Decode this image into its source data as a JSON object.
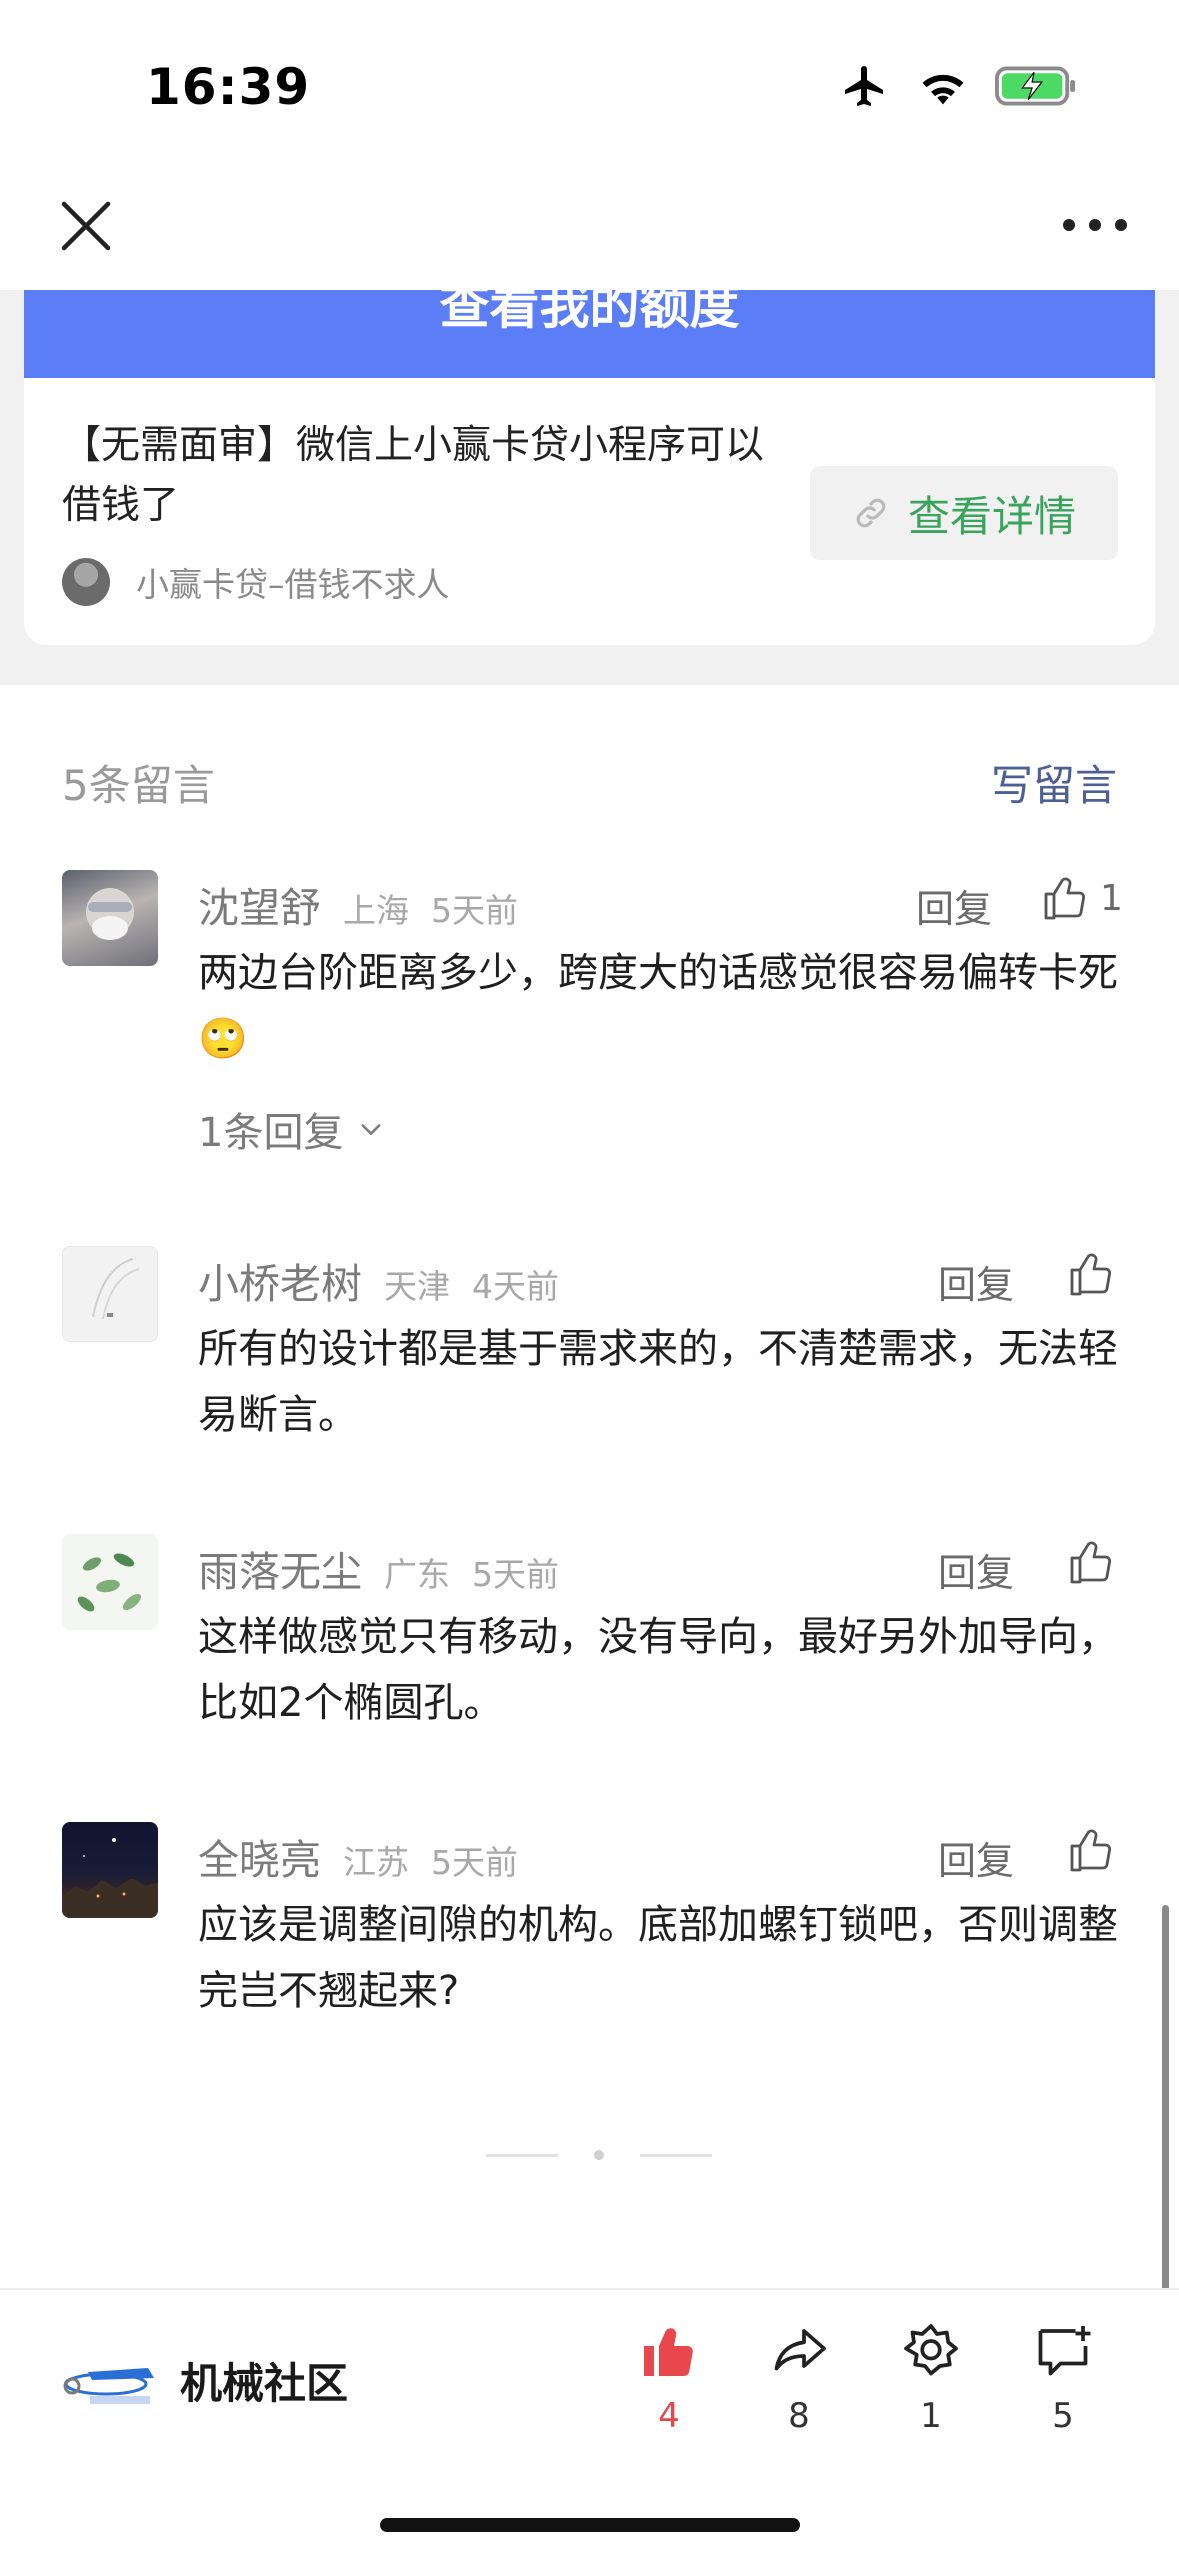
{
  "status": {
    "time": "16:39"
  },
  "ad": {
    "banner_text": "查看我的额度",
    "title": "【无需面审】微信上小赢卡贷小程序可以借钱了",
    "source": "小赢卡贷–借钱不求人",
    "button_label": "查看详情",
    "button_color": "#3aa35c"
  },
  "comments_header": {
    "count": "5条留言",
    "write": "写留言"
  },
  "comments": [
    {
      "name": "沈望舒",
      "region": "上海",
      "time": "5天前",
      "reply": "回复",
      "likes": "1",
      "text": "两边台阶距离多少，跨度大的话感觉很容易偏转卡死🙄",
      "replies_label": "1条回复"
    },
    {
      "name": "小桥老树",
      "region": "天津",
      "time": "4天前",
      "reply": "回复",
      "likes": "",
      "text": "所有的设计都是基于需求来的，不清楚需求，无法轻易断言。"
    },
    {
      "name": "雨落无尘",
      "region": "广东",
      "time": "5天前",
      "reply": "回复",
      "likes": "",
      "text": "这样做感觉只有移动，没有导向，最好另外加导向，比如2个椭圆孔。"
    },
    {
      "name": "全晓亮",
      "region": "江苏",
      "time": "5天前",
      "reply": "回复",
      "likes": "",
      "text": "应该是调整间隙的机构。底部加螺钉锁吧，否则调整完岂不翘起来?"
    }
  ],
  "bottom": {
    "brand_name": "机械社区",
    "actions": [
      {
        "icon": "thumbs-up-filled-icon",
        "count": "4",
        "color": "#e8474c"
      },
      {
        "icon": "share-icon",
        "count": "8"
      },
      {
        "icon": "wow-icon",
        "count": "1"
      },
      {
        "icon": "comment-icon",
        "count": "5"
      }
    ]
  }
}
